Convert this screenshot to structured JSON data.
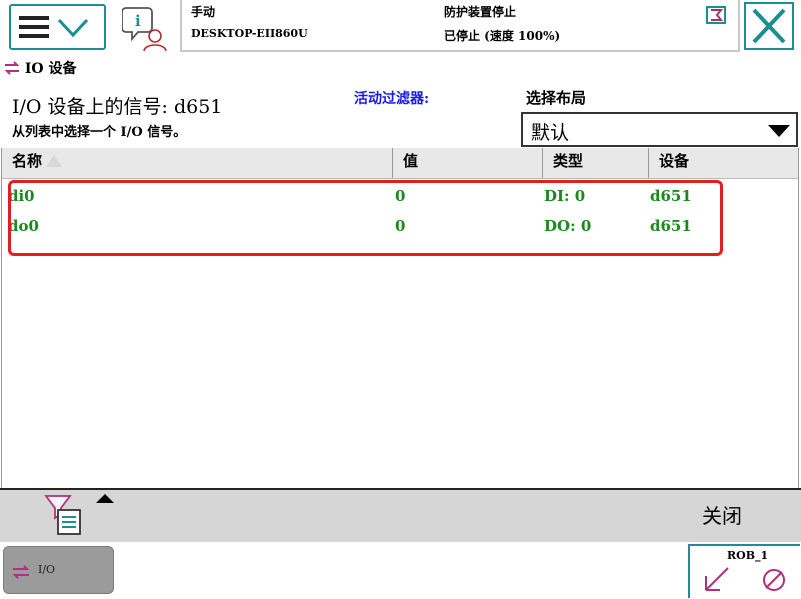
{
  "header": {
    "mode": "手动",
    "host": "DESKTOP-EII860U",
    "state": "防护装置停止",
    "speed_status": "已停止 (速度 100%)"
  },
  "app": {
    "title": "IO 设备"
  },
  "signals": {
    "title": "I/O 设备上的信号: d651",
    "subtitle": "从列表中选择一个 I/O 信号。"
  },
  "filter": {
    "label": "活动过滤器:"
  },
  "layout": {
    "label": "选择布局",
    "value": "默认"
  },
  "table": {
    "columns": [
      "名称",
      "值",
      "类型",
      "设备"
    ],
    "rows": [
      {
        "name": "di0",
        "value": "0",
        "type": "DI: 0",
        "device": "d651"
      },
      {
        "name": "do0",
        "value": "0",
        "type": "DO: 0",
        "device": "d651"
      }
    ]
  },
  "toolbar": {
    "close_label": "关闭"
  },
  "taskbar": {
    "io_label": "I/O",
    "rob_label": "ROB_1"
  },
  "colors": {
    "accent": "#1b8f8f",
    "signal_text": "#1a8a1a",
    "filter_label": "#1a1ae6",
    "highlight": "#e02020"
  }
}
